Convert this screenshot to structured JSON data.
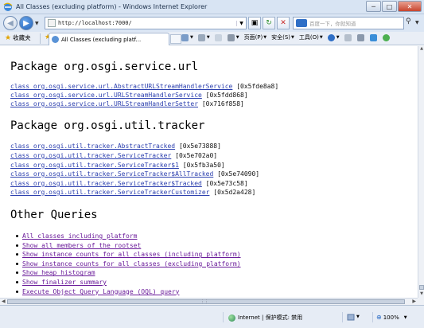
{
  "window": {
    "title": "All Classes (excluding platform) - Windows Internet Explorer",
    "minimize": "─",
    "maximize": "□",
    "close": "✕"
  },
  "address_bar": {
    "url": "http://localhost:7000/",
    "search_placeholder": "百度一下，你就知道"
  },
  "favorites": {
    "label": "收藏夹"
  },
  "tab": {
    "label": "All Classes (excluding platf..."
  },
  "commands": {
    "page": "页面(P)",
    "safety": "安全(S)",
    "tools": "工具(O)"
  },
  "content": {
    "sections": [
      {
        "heading": "Package org.osgi.service.url",
        "classes": [
          {
            "name": "class org.osgi.service.url.AbstractURLStreamHandlerService",
            "addr": "[0x5fde8a8]"
          },
          {
            "name": "class org.osgi.service.url.URLStreamHandlerService",
            "addr": "[0x5fdd868]"
          },
          {
            "name": "class org.osgi.service.url.URLStreamHandlerSetter",
            "addr": "[0x716f858]"
          }
        ]
      },
      {
        "heading": "Package org.osgi.util.tracker",
        "classes": [
          {
            "name": "class org.osgi.util.tracker.AbstractTracked",
            "addr": "[0x5e73888]"
          },
          {
            "name": "class org.osgi.util.tracker.ServiceTracker",
            "addr": "[0x5e702a0]"
          },
          {
            "name": "class org.osgi.util.tracker.ServiceTracker$1",
            "addr": "[0x5fb3a50]"
          },
          {
            "name": "class org.osgi.util.tracker.ServiceTracker$AllTracked",
            "addr": "[0x5e74090]"
          },
          {
            "name": "class org.osgi.util.tracker.ServiceTracker$Tracked",
            "addr": "[0x5e73c58]"
          },
          {
            "name": "class org.osgi.util.tracker.ServiceTrackerCustomizer",
            "addr": "[0x5d2a428]"
          }
        ]
      }
    ],
    "other_queries_heading": "Other Queries",
    "queries": [
      "All classes including platform",
      "Show all members of the rootset",
      "Show instance counts for all classes (including platform)",
      "Show instance counts for all classes (excluding platform)",
      "Show heap histogram",
      "Show finalizer summary",
      "Execute Object Query Language (OQL) query"
    ]
  },
  "status": {
    "zone": "Internet | 保护模式: 禁用",
    "zoom": "100%"
  },
  "colors": {
    "link": "#2b3fae",
    "visited_link": "#6a1b9a",
    "chrome": "#dbe6f4"
  },
  "icons": [
    "ie-icon",
    "back-icon",
    "forward-icon",
    "refresh-icon",
    "stop-icon",
    "search-icon",
    "favorites-star-icon",
    "home-icon",
    "feeds-icon",
    "print-icon",
    "help-icon",
    "globe-icon",
    "zoom-icon"
  ]
}
